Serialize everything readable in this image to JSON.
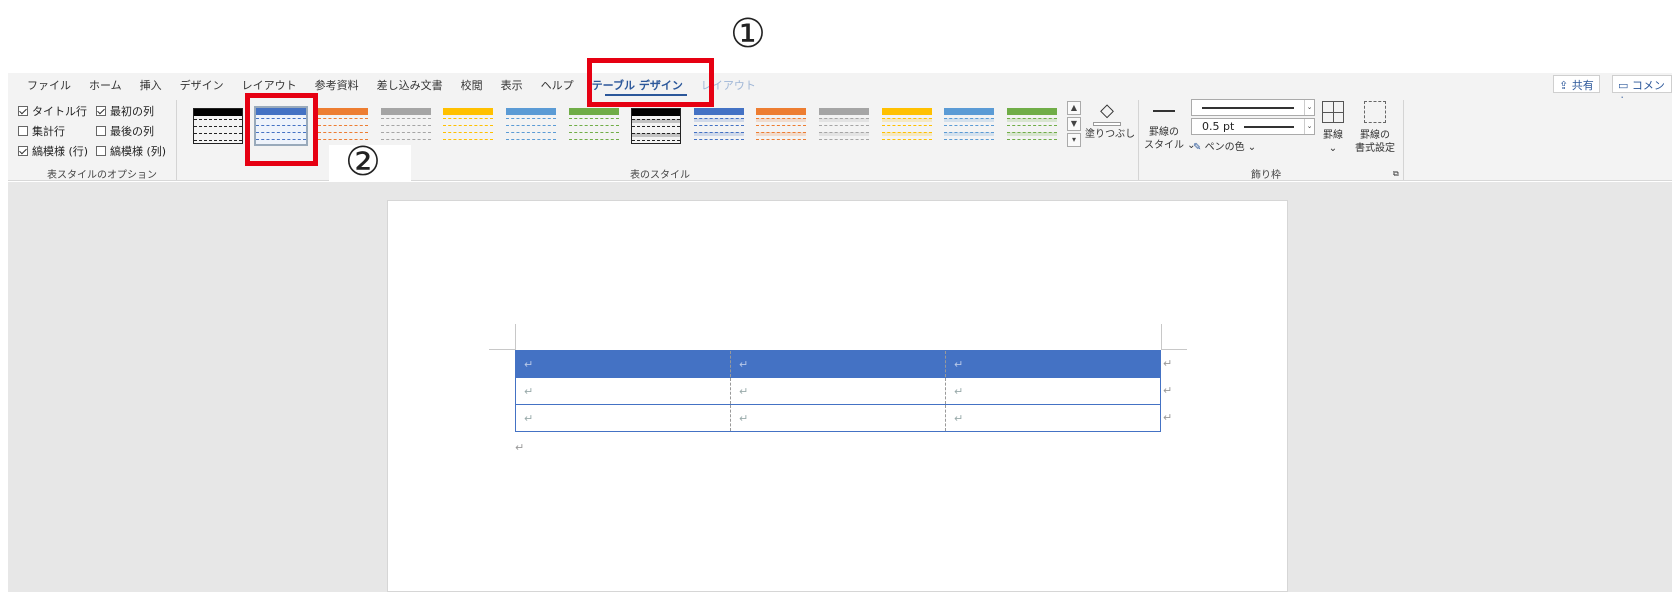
{
  "annotations": {
    "step1": "①",
    "step2": "②"
  },
  "menu": {
    "tabs": [
      "ファイル",
      "ホーム",
      "挿入",
      "デザイン",
      "レイアウト",
      "参考資料",
      "差し込み文書",
      "校閲",
      "表示",
      "ヘルプ",
      "テーブル デザイン",
      "レイアウト"
    ],
    "active_tab": "テーブル デザイン",
    "share": "共有",
    "comment": "コメント"
  },
  "options": {
    "items": [
      {
        "label": "タイトル行",
        "checked": true
      },
      {
        "label": "最初の列",
        "checked": true
      },
      {
        "label": "集計行",
        "checked": false
      },
      {
        "label": "最後の列",
        "checked": false
      },
      {
        "label": "縞模様 (行)",
        "checked": true
      },
      {
        "label": "縞模様 (列)",
        "checked": false
      }
    ],
    "group_label": "表スタイルのオプション"
  },
  "styles": {
    "group_label": "表のスタイル",
    "shading_label": "塗りつぶし",
    "swatch_colors": [
      "#000000",
      "#4472c4",
      "#ed7d31",
      "#a5a5a5",
      "#ffc000",
      "#5b9bd5",
      "#70ad47",
      "#000000",
      "#4472c4",
      "#ed7d31",
      "#a5a5a5",
      "#ffc000",
      "#5b9bd5",
      "#70ad47"
    ],
    "selected_index": 1
  },
  "borders": {
    "border_style_label_1": "罫線の",
    "border_style_label_2": "スタイル",
    "weight": "0.5 pt",
    "pen_color": "ペンの色",
    "borders_label": "罫線",
    "painter_label_1": "罫線の",
    "painter_label_2": "書式設定",
    "group_label": "飾り枠"
  },
  "document": {
    "paragraph_mark": "↵",
    "cell_mark": "↵",
    "accent": "#4472c4"
  }
}
